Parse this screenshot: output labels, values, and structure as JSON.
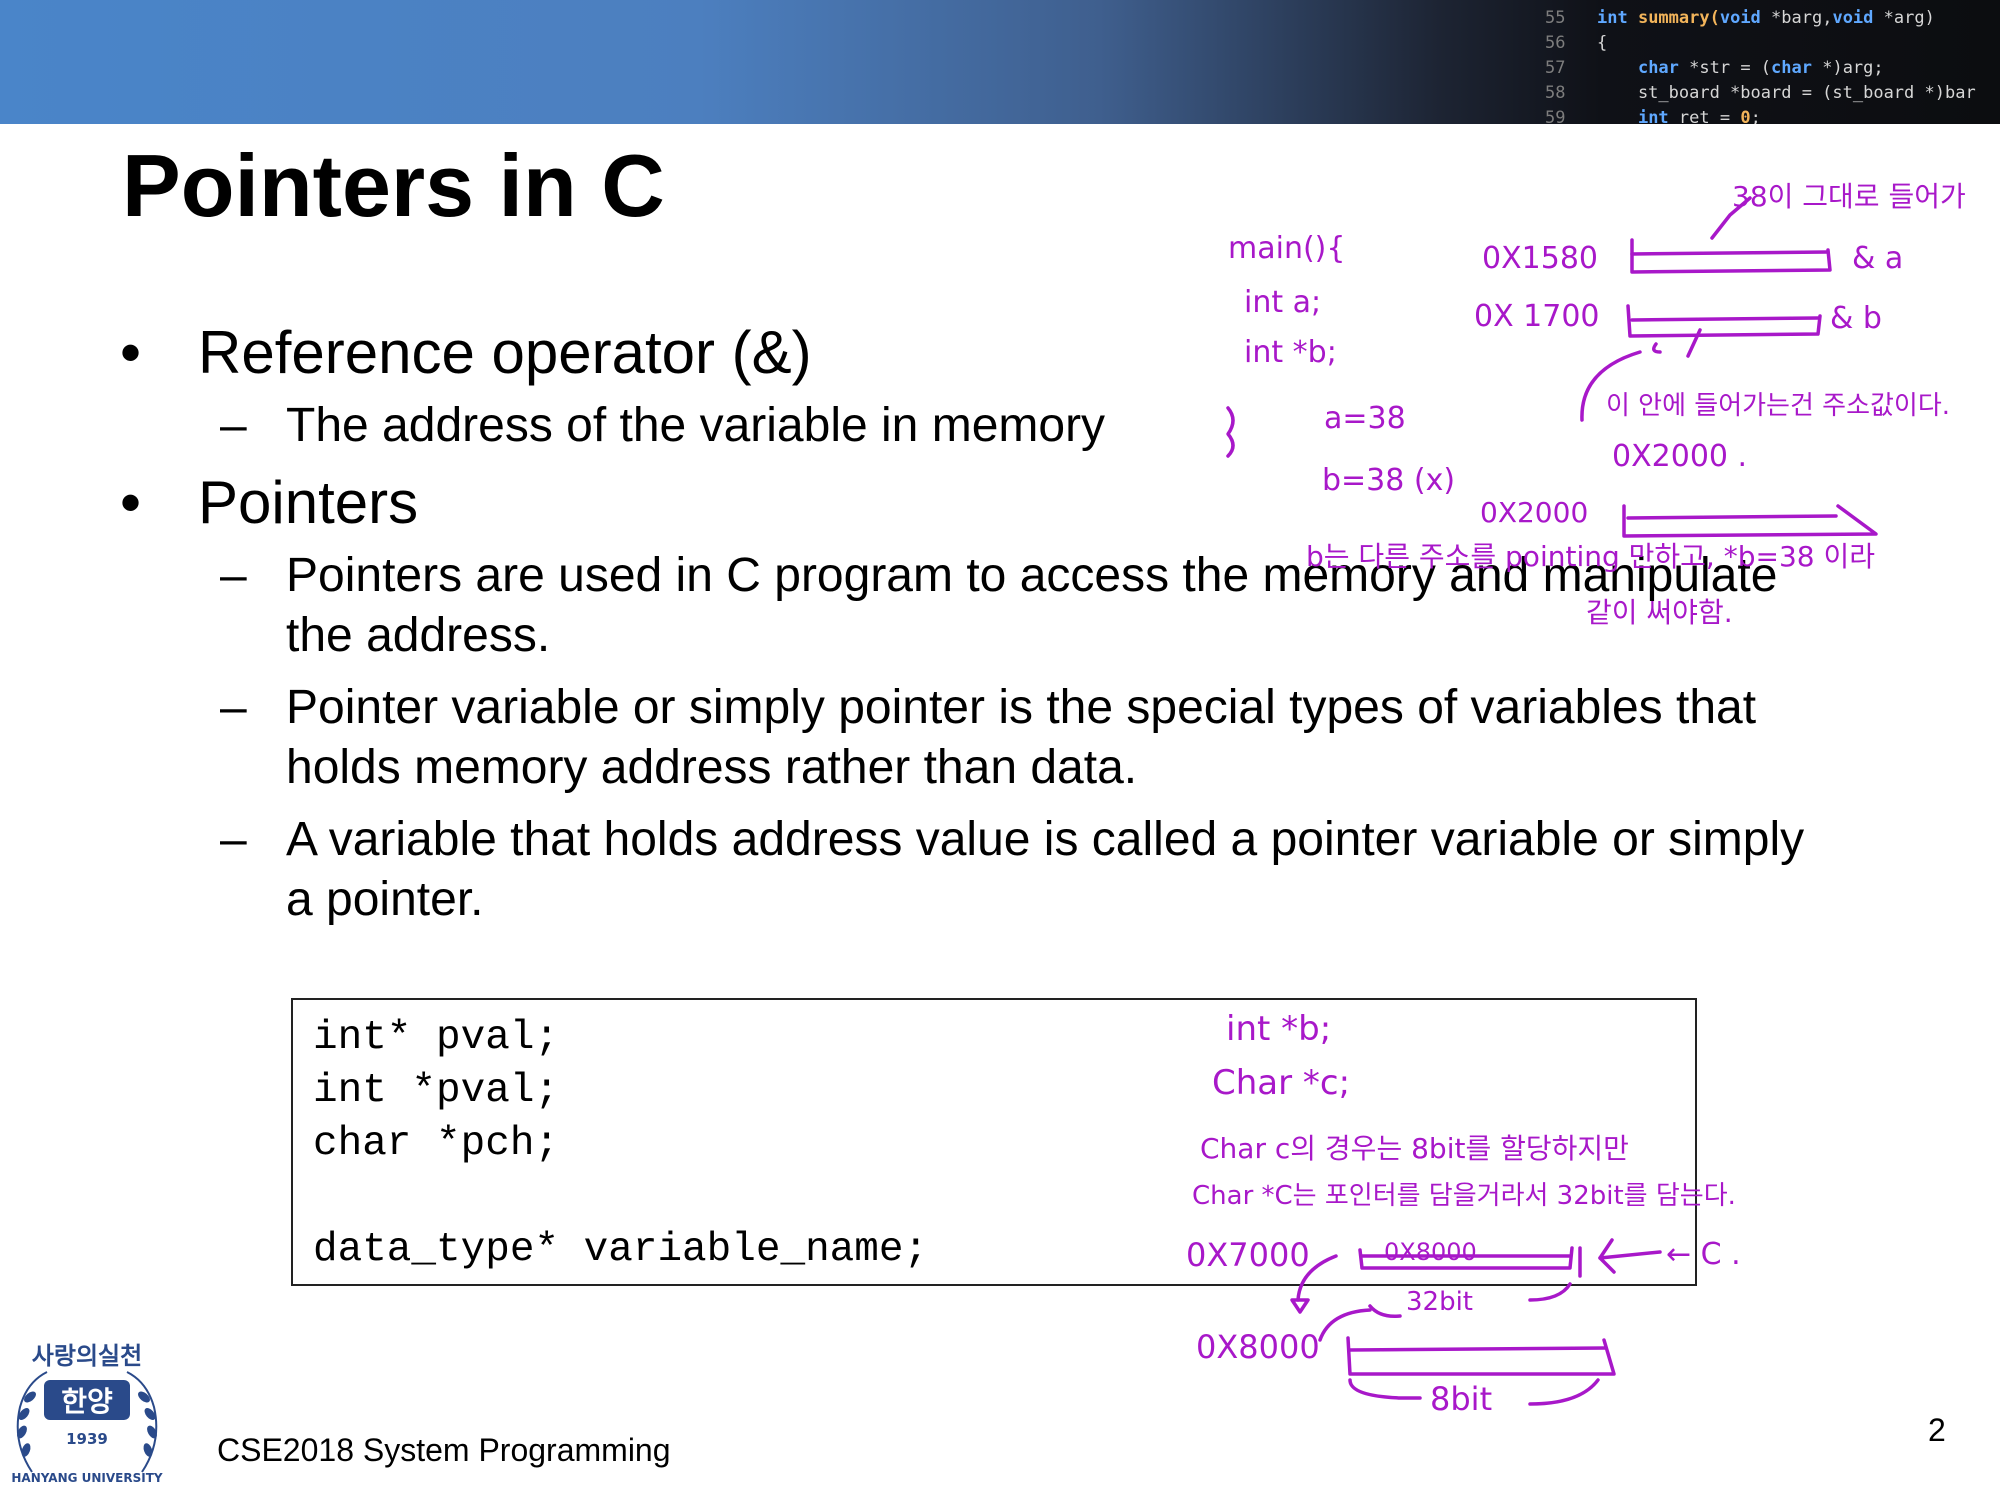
{
  "banner": {
    "code_lines": [
      {
        "num": "55",
        "text_parts": [
          [
            "kw",
            "int "
          ],
          [
            "fn",
            "summary("
          ],
          [
            "kw",
            "void "
          ],
          [
            "plain",
            "*barg,"
          ],
          [
            "kw",
            "void "
          ],
          [
            "plain",
            "*arg)"
          ]
        ]
      },
      {
        "num": "56",
        "text_parts": [
          [
            "plain",
            "{"
          ]
        ]
      },
      {
        "num": "57",
        "text_parts": [
          [
            "plain",
            "    "
          ],
          [
            "kw",
            "char "
          ],
          [
            "plain",
            "*str = ("
          ],
          [
            "kw",
            "char "
          ],
          [
            "plain",
            "*)arg;"
          ]
        ]
      },
      {
        "num": "58",
        "text_parts": [
          [
            "plain",
            "    st_board *board = (st_board *)bar"
          ]
        ]
      },
      {
        "num": "59",
        "text_parts": [
          [
            "plain",
            "    "
          ],
          [
            "kw",
            "int "
          ],
          [
            "plain",
            "ret = "
          ],
          [
            "fn",
            "0"
          ],
          [
            "plain",
            ";"
          ]
        ]
      }
    ]
  },
  "slide": {
    "title": "Pointers in C",
    "bullets": [
      {
        "text": "Reference operator (&)",
        "subs": [
          "The address of the variable in memory"
        ]
      },
      {
        "text": "Pointers",
        "subs": [
          "Pointers are used in C program to access the memory and manipulate the address.",
          "Pointer variable or simply pointer is the special types of variables that holds memory address rather than data.",
          "A variable that holds address value is called a pointer variable or simply a pointer."
        ]
      }
    ],
    "code_lines": [
      "int* pval;",
      "int *pval;",
      "char *pch;",
      "",
      "data_type* variable_name;"
    ],
    "footer": "CSE2018 System Programming",
    "page_number": "2"
  },
  "logo": {
    "arc_text": "사랑의실천",
    "name": "한양",
    "year": "1939",
    "bottom_text": "HANYANG UNIVERSITY"
  },
  "annotations": {
    "color": "#a818c9",
    "code_left": [
      "main(){",
      "int a;",
      "int *b;",
      "}"
    ],
    "assign": [
      "a=38",
      "b=38 (x)"
    ],
    "addr_a": "0X1580",
    "label_a": "& a",
    "addr_b": "0X 1700",
    "label_b": "& b",
    "note_top": "38이 그대로 들어가",
    "note_mid": "이 안에 들어가는건 주소값이다.",
    "addr_2000": "0X2000 .",
    "addr_2000_box": "0X2000",
    "note_point": "b는 다른 주소를 pointing 만하고, *b=38 이라",
    "note_point2": "같이 써야함.",
    "decl": [
      "int *b;",
      "Char *c;"
    ],
    "note_char1": "Char c의 경우는 8bit를 할당하지만",
    "note_char2": "Char *C는 포인터를 담을거라서 32bit를 담는다.",
    "addr_7000": "0X7000",
    "addr_8000_in": "0X8000",
    "arrow_c": "← C .",
    "bits32": "32bit",
    "addr_8000": "0X8000",
    "bits8": "8bit"
  }
}
